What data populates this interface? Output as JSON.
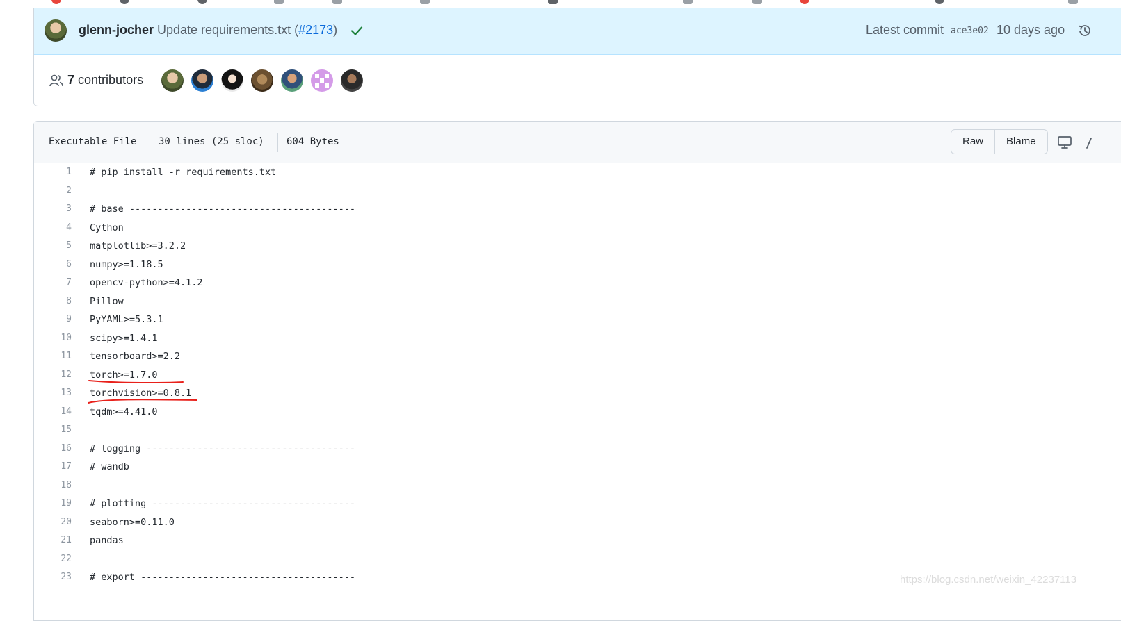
{
  "commit": {
    "author": "glenn-jocher",
    "message_prefix": "Update requirements.txt (",
    "pr_ref": "#2173",
    "message_suffix": ")",
    "latest_label": "Latest commit",
    "sha": "ace3e02",
    "age": "10 days ago"
  },
  "contributors": {
    "count": "7",
    "label": "contributors"
  },
  "file": {
    "kind": "Executable File",
    "lines": "30 lines (25 sloc)",
    "size": "604 Bytes",
    "raw_label": "Raw",
    "blame_label": "Blame"
  },
  "code_lines": [
    {
      "n": "1",
      "text": "# pip install -r requirements.txt"
    },
    {
      "n": "2",
      "text": ""
    },
    {
      "n": "3",
      "text": "# base ----------------------------------------"
    },
    {
      "n": "4",
      "text": "Cython"
    },
    {
      "n": "5",
      "text": "matplotlib>=3.2.2"
    },
    {
      "n": "6",
      "text": "numpy>=1.18.5"
    },
    {
      "n": "7",
      "text": "opencv-python>=4.1.2"
    },
    {
      "n": "8",
      "text": "Pillow"
    },
    {
      "n": "9",
      "text": "PyYAML>=5.3.1"
    },
    {
      "n": "10",
      "text": "scipy>=1.4.1"
    },
    {
      "n": "11",
      "text": "tensorboard>=2.2"
    },
    {
      "n": "12",
      "text": "torch>=1.7.0"
    },
    {
      "n": "13",
      "text": "torchvision>=0.8.1"
    },
    {
      "n": "14",
      "text": "tqdm>=4.41.0"
    },
    {
      "n": "15",
      "text": ""
    },
    {
      "n": "16",
      "text": "# logging -------------------------------------"
    },
    {
      "n": "17",
      "text": "# wandb"
    },
    {
      "n": "18",
      "text": ""
    },
    {
      "n": "19",
      "text": "# plotting ------------------------------------"
    },
    {
      "n": "20",
      "text": "seaborn>=0.11.0"
    },
    {
      "n": "21",
      "text": "pandas"
    },
    {
      "n": "22",
      "text": ""
    },
    {
      "n": "23",
      "text": "# export --------------------------------------"
    }
  ],
  "watermark": "https://blog.csdn.net/weixin_42237113",
  "colors": {
    "commit_bg": "#ddf4ff",
    "link": "#0969da",
    "success": "#1a7f37",
    "annotation": "#e8201a"
  }
}
